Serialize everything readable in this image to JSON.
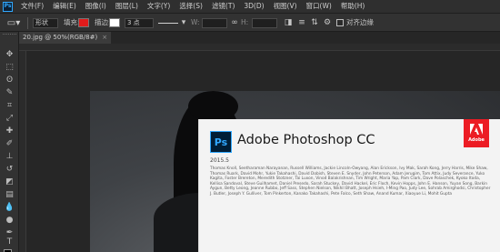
{
  "menubar": {
    "logo": "Ps",
    "items": [
      "文件(F)",
      "编辑(E)",
      "图像(I)",
      "图层(L)",
      "文字(Y)",
      "选择(S)",
      "滤镜(T)",
      "3D(D)",
      "视图(V)",
      "窗口(W)",
      "帮助(H)"
    ]
  },
  "options": {
    "mode_label": "形状",
    "fill_label": "填充:",
    "fill_color": "#e01b1b",
    "stroke_label": "描边:",
    "stroke_width": "3 点",
    "align_edges_label": "对齐边缘"
  },
  "tab": {
    "label": "20.jpg @ 50%(RGB/8#)",
    "close": "×"
  },
  "splash": {
    "icon": "Ps",
    "title": "Adobe Photoshop CC",
    "version": "2015.5",
    "adobe_text": "Adobe",
    "credits": "Thomas Knoll, Seetharaman Narayanan, Russell Williams, Jackie Lincoln-Owyang, Alan Erickson, Ivy Mak, Sarah Kong, Jerry Harris, Mike Shaw, Thomas Ruark, David Mohr, Yukie Takahashi, David Dobish, Steven E. Snyder, John Peterson, Adam Jerugim, Tom Attix, Judy Severance, Yuko Kagita, Foster Brereton, Meredith Stotzner, Tai Luxon, Vinod Balakrishnan, Tim Wright, Maria Yap, Pam Clark, Dave Polaschek, Kyoko Itoda, Kellisa Sandoval, Steve Guilhamet, Daniel Presedo, Sarah Stuckey, David Hackel, Eric Floch, Kevin Hopps, John E. Hanson, Yuyan Song, Barkin Aygun, Betty Leong, Jeanne Rubbo, Jeff Sass, Stephen Nielson, Nikhil Bhatt, Joseph Hsieh, I-Ming Pao, Judy Lee, Sohrab Amirghodsi, Christopher J. Butler, Joseph Y. Gulliver, Tom Pinkerton, Kanako Takahashi, Pete Falco, Seth Shaw, Anand Kumar, Xiaoyue Li, Mohit Gupta"
  }
}
